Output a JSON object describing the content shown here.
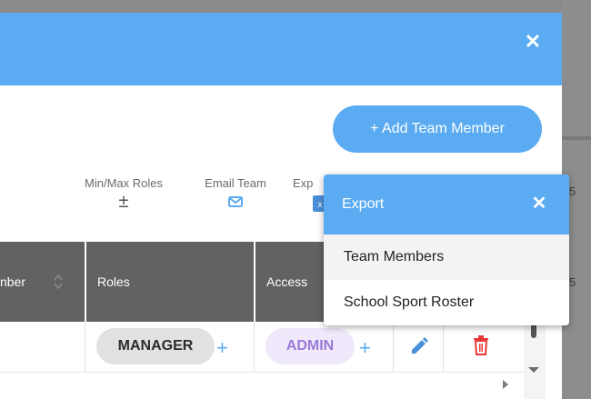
{
  "modal": {
    "close_glyph": "✕",
    "add_button_label": "+ Add Team Member"
  },
  "toolbar": {
    "minmax_label": "Min/Max Roles",
    "minmax_glyph": "±",
    "email_label": "Email Team",
    "export_label": "Exp"
  },
  "table": {
    "headers": {
      "member": "nber",
      "roles": "Roles",
      "access": "Access"
    },
    "row": {
      "role": "MANAGER",
      "access": "ADMIN",
      "add_glyph": "+"
    }
  },
  "export_menu": {
    "title": "Export",
    "close_glyph": "✕",
    "items": [
      "Team Members",
      "School Sport Roster"
    ]
  },
  "backdrop": {
    "digit_top": "5",
    "digit_bottom": "5"
  },
  "colors": {
    "accent": "#5aabf2",
    "header_bg": "#626262",
    "delete": "#e53935",
    "admin_text": "#9a7ad8"
  },
  "icons": [
    "plus-minus-icon",
    "email-icon",
    "excel-icon",
    "sort-icon",
    "edit-icon",
    "delete-icon",
    "close-icon"
  ]
}
